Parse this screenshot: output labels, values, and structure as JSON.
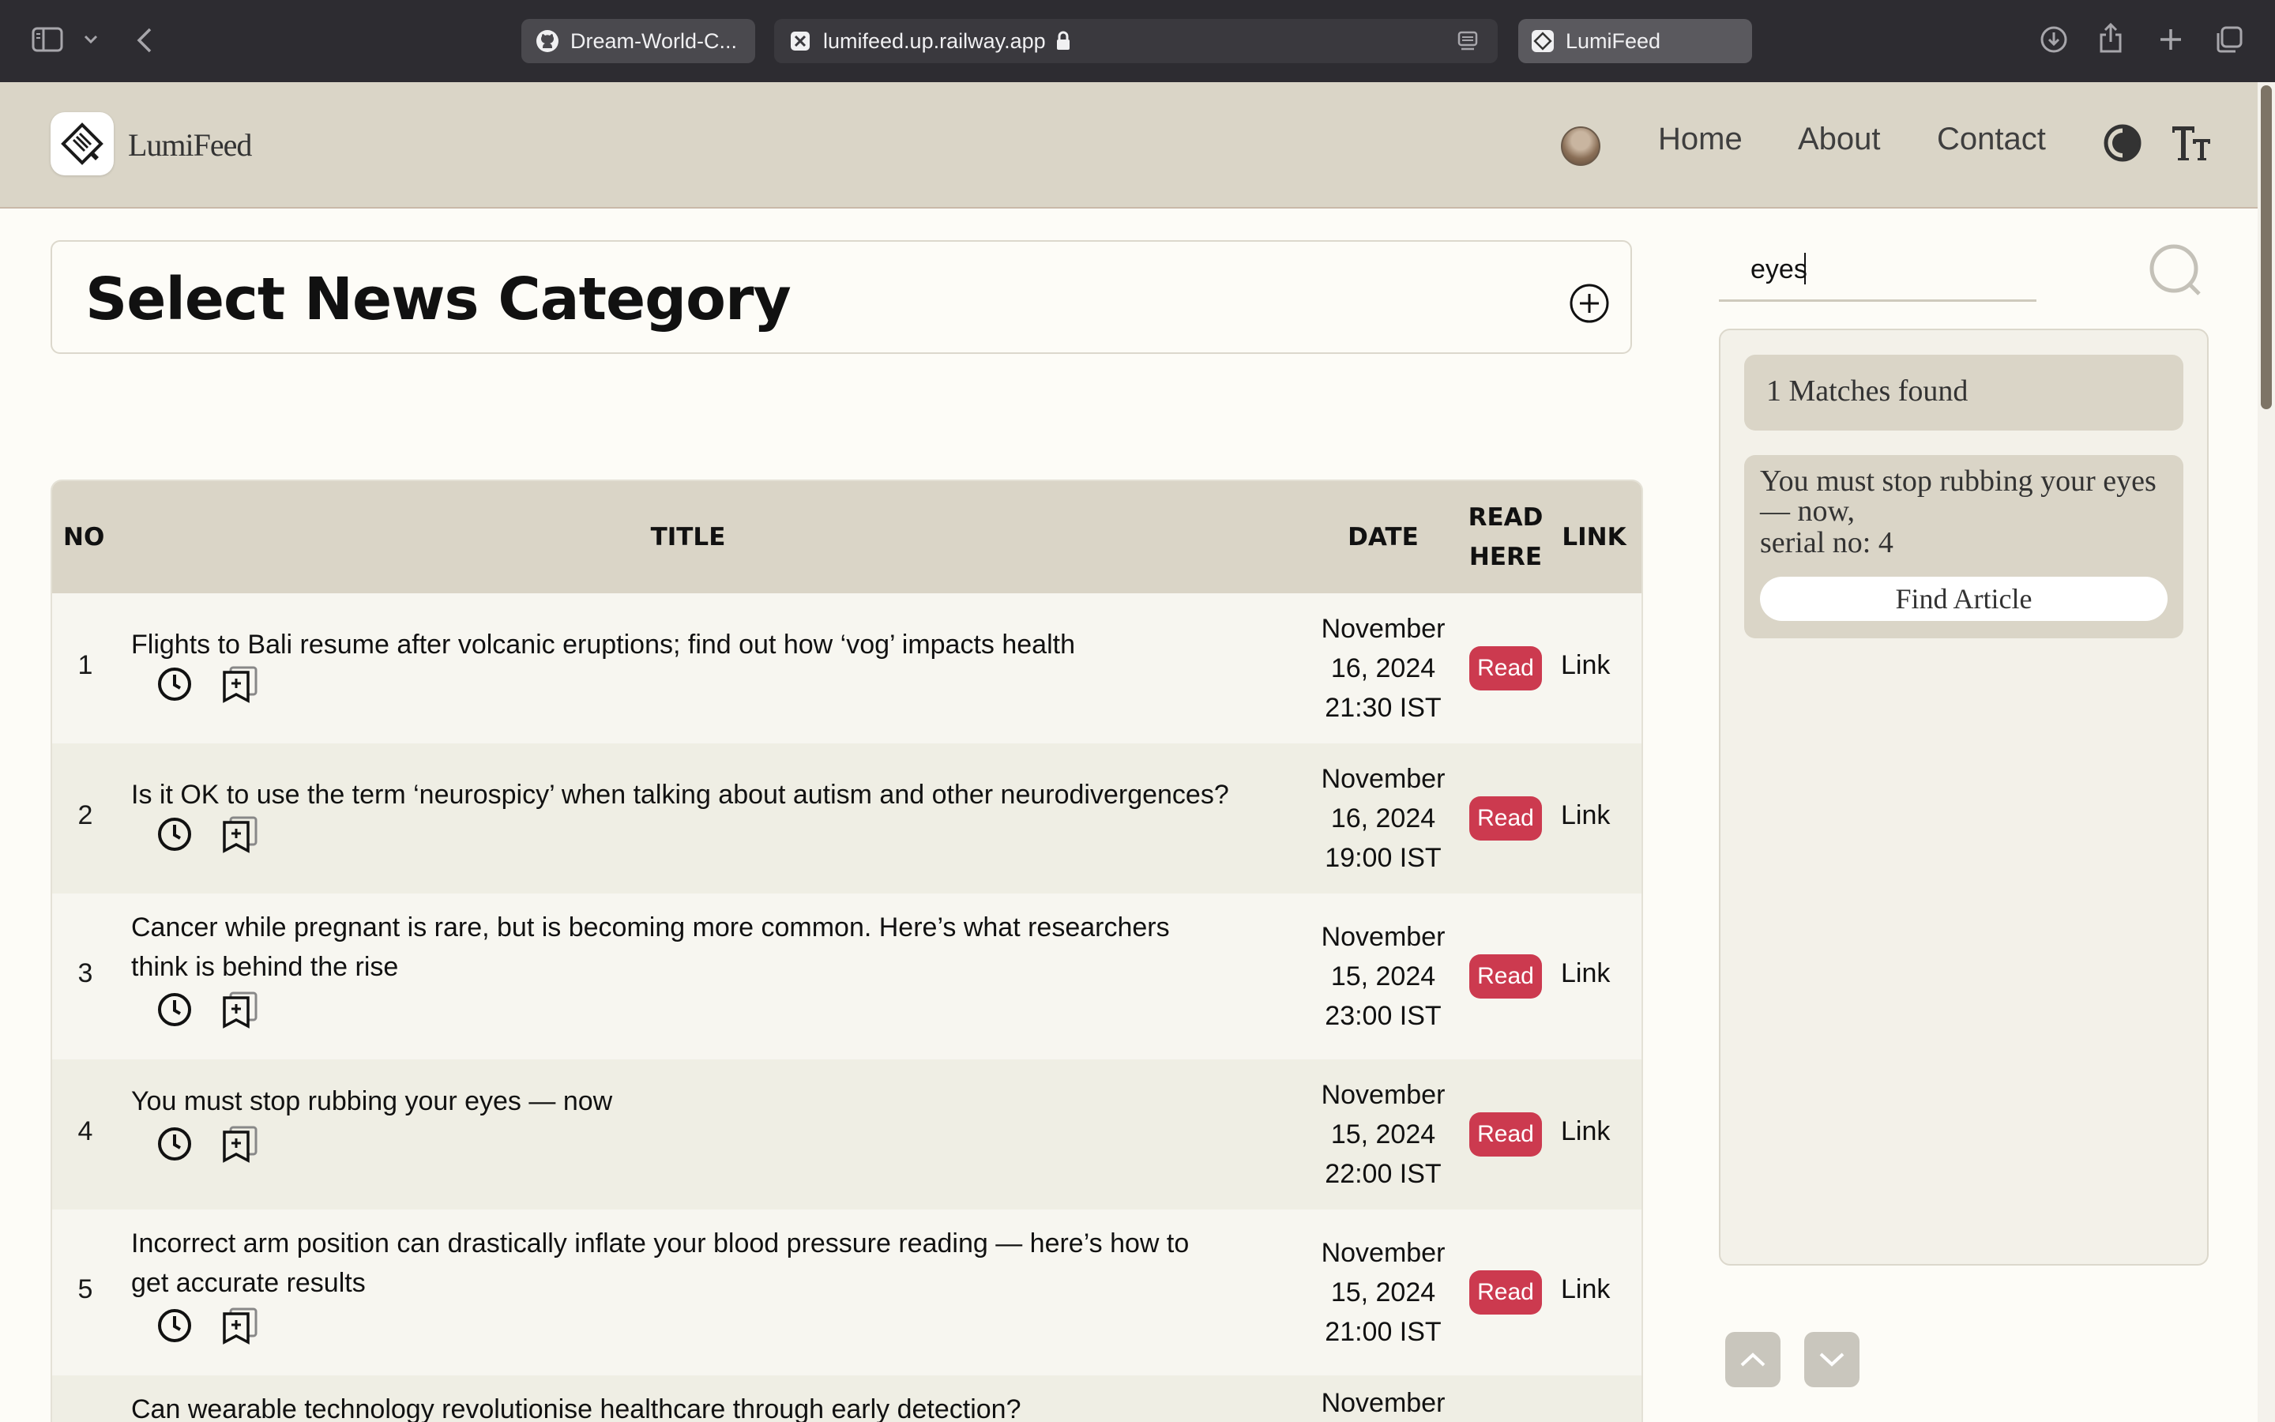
{
  "browser": {
    "tabs": [
      {
        "label": "Dream-World-C...",
        "icon": "github-icon"
      },
      {
        "label": "lumifeed.up.railway.app",
        "icon": "favicon-x-icon"
      },
      {
        "label": "LumiFeed",
        "icon": "lumifeed-favicon-icon"
      }
    ]
  },
  "header": {
    "brand": "LumiFeed",
    "nav": {
      "home": "Home",
      "about": "About",
      "contact": "Contact"
    },
    "text_size_glyph": "TT"
  },
  "category": {
    "title": "Select News Category"
  },
  "table": {
    "headers": {
      "no": "NO",
      "title": "TITLE",
      "date": "DATE",
      "read_line1": "READ",
      "read_line2": "HERE",
      "link": "LINK"
    },
    "rows": [
      {
        "no": "1",
        "title": "Flights to Bali resume after volcanic eruptions; find out how ‘vog’ impacts health",
        "date1": "November",
        "date2": "16, 2024",
        "date3": "21:30 IST",
        "read": "Read",
        "link": "Link"
      },
      {
        "no": "2",
        "title": "Is it OK to use the term ‘neurospicy’ when talking about autism and other neurodivergences?",
        "date1": "November",
        "date2": "16, 2024",
        "date3": "19:00 IST",
        "read": "Read",
        "link": "Link"
      },
      {
        "no": "3",
        "title_l1": "Cancer while pregnant is rare, but is becoming more common. Here’s what researchers",
        "title_l2": "think is behind the rise",
        "date1": "November",
        "date2": "15, 2024",
        "date3": "23:00 IST",
        "read": "Read",
        "link": "Link"
      },
      {
        "no": "4",
        "title": "You must stop rubbing your eyes — now",
        "date1": "November",
        "date2": "15, 2024",
        "date3": "22:00 IST",
        "read": "Read",
        "link": "Link"
      },
      {
        "no": "5",
        "title_l1": "Incorrect arm position can drastically inflate your blood pressure reading — here’s how to",
        "title_l2": "get accurate results",
        "date1": "November",
        "date2": "15, 2024",
        "date3": "21:00 IST",
        "read": "Read",
        "link": "Link"
      },
      {
        "title": "Can wearable technology revolutionise healthcare through early detection?",
        "date1": "November"
      }
    ]
  },
  "search": {
    "value": "eyes",
    "match_count": "1 Matches found",
    "result_title_l1": "You must stop rubbing your eyes",
    "result_title_l2": "— now,",
    "result_serial": "serial no: 4",
    "find_button": "Find Article"
  },
  "colors": {
    "header_bg": "#dad5c7",
    "page_bg": "#fdfcf7",
    "read_button": "#cc3a4f",
    "chrome_bg": "#2d2c31"
  }
}
